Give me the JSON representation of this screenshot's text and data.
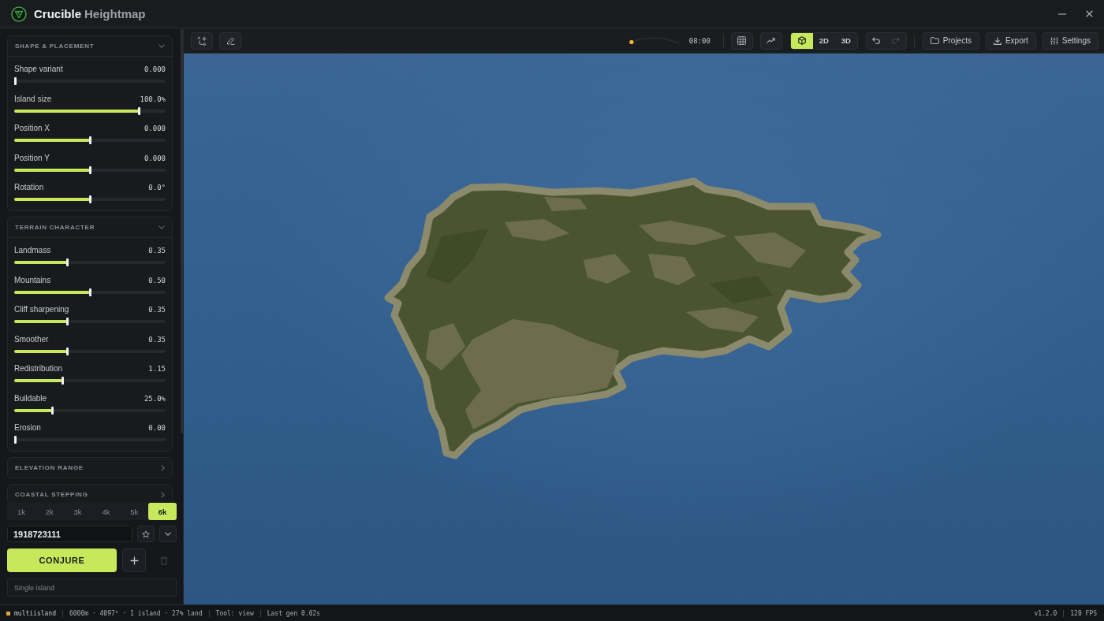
{
  "window": {
    "title": "Crucible",
    "subtitle": "Heightmap"
  },
  "sidebar": {
    "sections": [
      {
        "title": "SHAPE & PLACEMENT",
        "expanded": true,
        "sliders": [
          {
            "label": "Shape variant",
            "value": "0.000",
            "level": 0
          },
          {
            "label": "Island size",
            "value": "100.0%",
            "level": 0.83
          },
          {
            "label": "Position X",
            "value": "0.000",
            "level": 0.5
          },
          {
            "label": "Position Y",
            "value": "0.000",
            "level": 0.5
          },
          {
            "label": "Rotation",
            "value": "0.0°",
            "level": 0.5
          }
        ]
      },
      {
        "title": "TERRAIN CHARACTER",
        "expanded": true,
        "sliders": [
          {
            "label": "Landmass",
            "value": "0.35",
            "level": 0.35
          },
          {
            "label": "Mountains",
            "value": "0.50",
            "level": 0.5
          },
          {
            "label": "Cliff sharpening",
            "value": "0.35",
            "level": 0.35
          },
          {
            "label": "Smoother",
            "value": "0.35",
            "level": 0.35
          },
          {
            "label": "Redistribution",
            "value": "1.15",
            "level": 0.32
          },
          {
            "label": "Buildable",
            "value": "25.0%",
            "level": 0.25
          },
          {
            "label": "Erosion",
            "value": "0.00",
            "level": 0
          }
        ]
      },
      {
        "title": "ELEVATION RANGE",
        "expanded": false
      },
      {
        "title": "COASTAL STEPPING",
        "expanded": false
      }
    ]
  },
  "resolutions": [
    {
      "label": "1k",
      "selected": false
    },
    {
      "label": "2k",
      "selected": false
    },
    {
      "label": "3k",
      "selected": false
    },
    {
      "label": "4k",
      "selected": false
    },
    {
      "label": "5k",
      "selected": false
    },
    {
      "label": "6k",
      "selected": true
    }
  ],
  "seed": {
    "value": "1918723111"
  },
  "generate_button": "CONJURE",
  "delete_button": {
    "disabled": true
  },
  "mode_field": {
    "placeholder": "Single island"
  },
  "toolbar": {
    "time": {
      "level": 0.06,
      "label": "08:00"
    },
    "view_modes": [
      {
        "kind": "icon",
        "selected": true
      },
      {
        "kind": "text",
        "label": "2D",
        "selected": false
      },
      {
        "kind": "text",
        "label": "3D",
        "selected": false
      }
    ],
    "undo": {
      "disabled": false
    },
    "redo": {
      "disabled": true
    },
    "buttons": [
      "Projects",
      "Export",
      "Settings"
    ]
  },
  "status_bar": {
    "project": "multiisland",
    "items": [
      "6000m · 4097² · 1 island · 27% land",
      "Tool: view",
      "Last gen 0.02s"
    ],
    "version": "v1.2.0",
    "fps": "120 FPS"
  }
}
